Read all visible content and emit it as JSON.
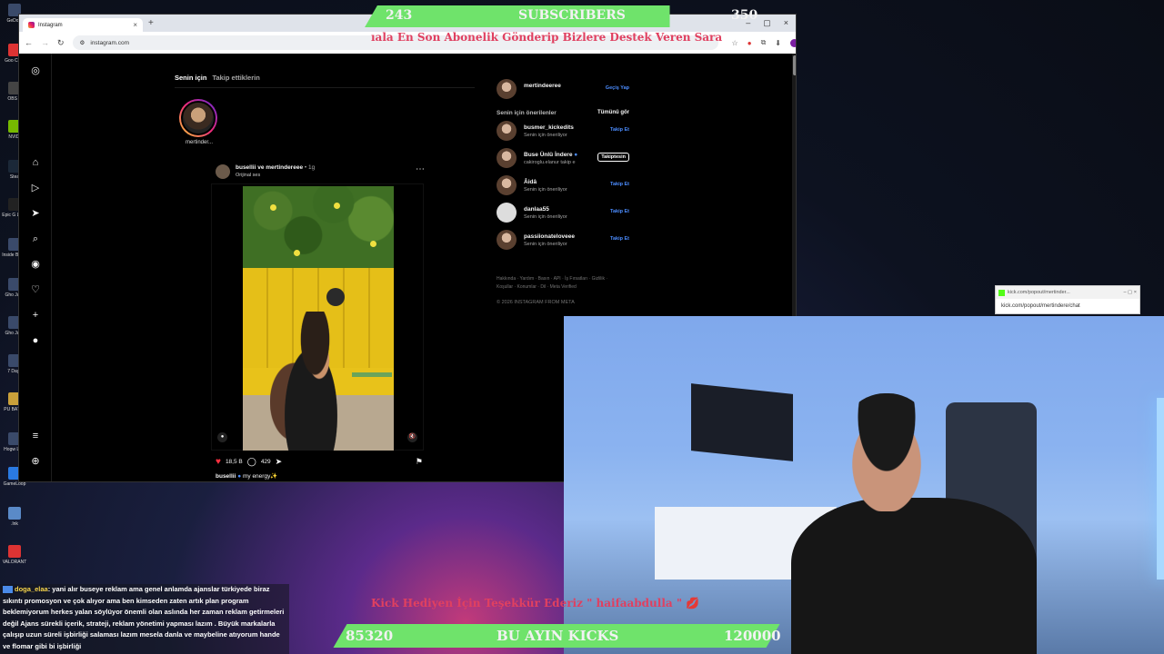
{
  "desktop": {
    "icons": [
      {
        "label": "GeDoni",
        "icon": "app-icon"
      },
      {
        "label": "Goo Chro",
        "icon": "chrome-icon"
      },
      {
        "label": "OBS S",
        "icon": "obs-icon"
      },
      {
        "label": "NVIDI",
        "icon": "nvidia-icon"
      },
      {
        "label": "Stea",
        "icon": "steam-icon"
      },
      {
        "label": "Epic G Laun",
        "icon": "epic-icon"
      },
      {
        "label": "Inside Backr",
        "icon": "game-icon"
      },
      {
        "label": "Gho Janil",
        "icon": "game-icon"
      },
      {
        "label": "Gho Janil",
        "icon": "game-icon"
      },
      {
        "label": "7 Days",
        "icon": "game-icon"
      },
      {
        "label": "PU BATTL",
        "icon": "pubg-icon"
      },
      {
        "label": "Hogw Legi",
        "icon": "game-icon"
      },
      {
        "label": "GameLoop",
        "icon": "gameloop-icon"
      },
      {
        "label": ".lnk",
        "icon": "shortcut-icon"
      },
      {
        "label": "VALORANT",
        "icon": "valorant-icon"
      }
    ]
  },
  "browser": {
    "tab_title": "Instagram",
    "url": "instagram.com"
  },
  "instagram": {
    "feed_tabs": {
      "for_you": "Senin için",
      "following": "Takip ettiklerin"
    },
    "story": {
      "name": "mertinder..."
    },
    "post": {
      "users": "busellii ve mertindereee",
      "dot": "•",
      "time": "1g",
      "audio": "Orijinal ses",
      "likes": "18,5 B",
      "comments": "429",
      "caption_user": "busellii",
      "caption_text": "my energy✨"
    },
    "me": {
      "username": "mertindeeree",
      "switch": "Geçiş Yap"
    },
    "suggestions_title": "Senin için önerilenler",
    "see_all": "Tümünü gör",
    "suggestions": [
      {
        "name": "busmer_kickedits",
        "sub": "Senin için öneriliyor",
        "action": "Takip Et"
      },
      {
        "name": "Buse Ünlü İndere",
        "sub": "cakiroglu.elanur takip e",
        "action": "Takiptesin"
      },
      {
        "name": "Âidâ",
        "sub": "Senin için öneriliyor",
        "action": "Takip Et"
      },
      {
        "name": "danlaa55",
        "sub": "Senin için öneriliyor",
        "action": "Takip Et"
      },
      {
        "name": "passiionateloveee",
        "sub": "Senin için öneriliyor",
        "action": "Takip Et"
      }
    ],
    "footer_line1": "Hakkında · Yardım · Basın · API · İş Fırsatları · Gizlilik ·",
    "footer_line2": "Koşullar · Konumlar · Dil · Meta Verified",
    "copyright": "© 2026 INSTAGRAM FROM META"
  },
  "overlay": {
    "subs_current": "243",
    "subs_label": "SUBSCRIBERS",
    "subs_goal": "350",
    "ticker_top": "ıala En Son Abonelik Gönderip Bizlere Destek Veren Sara",
    "kick_url_title": "kick.com/popout/mertinder...",
    "kick_url": "kick.com/popout/mertindere/chat",
    "ticker_bottom": "Kick Hediyen İçin Teşekkür Ederiz \" haifaabdulla \" 💋",
    "kicks_current": "85320",
    "kicks_label": "BU AYIN KICKS",
    "kicks_goal": "120000"
  },
  "chat": {
    "user": "doga_elaa",
    "message": ": yani alır buseye reklam ama genel anlamda ajanslar türkiyede biraz sıkıntı promosyon ve çok alıyor ama ben kimseden zaten artık plan program beklemiyorum herkes yalan söylüyor önemli olan aslında her zaman reklam getirmeleri değil Ajans sürekli içerik, strateji, reklam yönetimi yapması lazım . Büyük markalarla çalışıp uzun süreli işbirliği salaması lazım mesela danla ve maybeline atıyorum hande ve flomar gibi bi işbirliği"
  },
  "colors": {
    "accent_green": "#6fe36b",
    "ticker_red": "#e04060",
    "ig_link": "#4c8dff",
    "like_red": "#ff3040"
  }
}
